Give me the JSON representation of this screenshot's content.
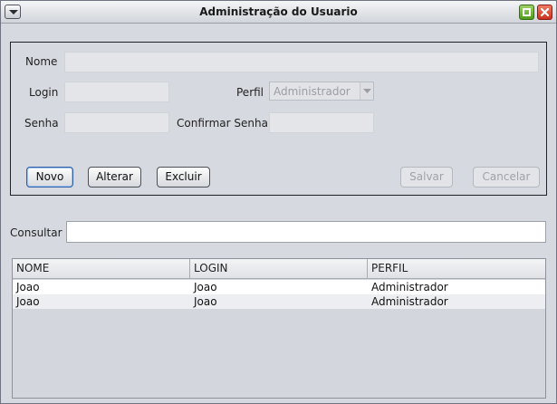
{
  "window": {
    "title": "Administração do Usuario"
  },
  "form": {
    "nome_label": "Nome",
    "login_label": "Login",
    "perfil_label": "Perfil",
    "perfil_value": "Administrador",
    "senha_label": "Senha",
    "confirmar_label": "Confirmar Senha",
    "nome_value": "",
    "login_value": "",
    "senha_value": "",
    "confirmar_value": ""
  },
  "buttons": {
    "novo": "Novo",
    "alterar": "Alterar",
    "excluir": "Excluir",
    "salvar": "Salvar",
    "cancelar": "Cancelar"
  },
  "search": {
    "label": "Consultar",
    "value": ""
  },
  "table": {
    "columns": [
      "NOME",
      "LOGIN",
      "PERFIL"
    ],
    "rows": [
      [
        "Joao",
        "Joao",
        "Administrador"
      ],
      [
        "Joao",
        "Joao",
        "Administrador"
      ]
    ]
  },
  "icons": {
    "system_menu": "chevron-down-icon",
    "maximize": "maximize-icon",
    "close": "close-icon"
  },
  "colors": {
    "maximize": "#5aa622",
    "close": "#d9422d",
    "focus": "#2d5ea8"
  }
}
